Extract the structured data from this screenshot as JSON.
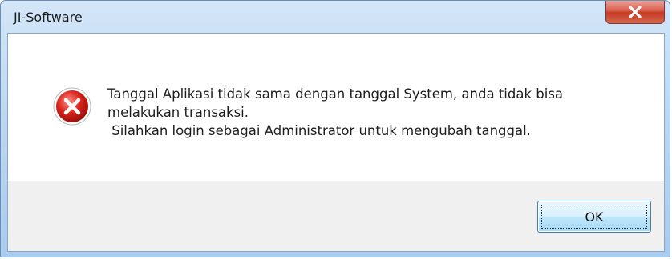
{
  "window": {
    "title": "JI-Software"
  },
  "titlebar": {
    "close_icon": "close-icon",
    "close_color": "#c53a22"
  },
  "dialog": {
    "icon": "error-icon",
    "icon_color": "#d21f1f",
    "message": "Tanggal Aplikasi tidak sama dengan tanggal System, anda tidak bisa\nmelakukan transaksi.\n Silahkan login sebagai Administrator untuk mengubah tanggal."
  },
  "buttons": {
    "ok_label": "OK"
  }
}
